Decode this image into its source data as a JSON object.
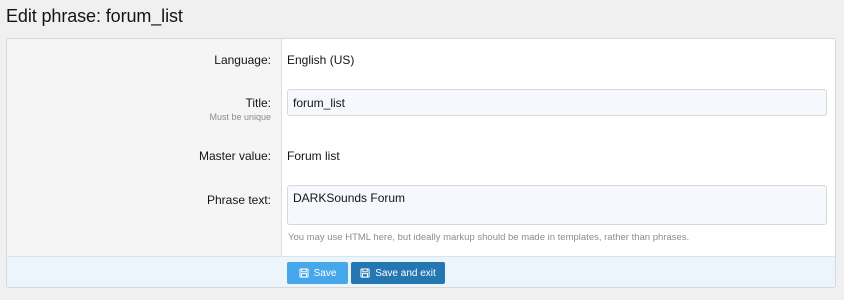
{
  "page": {
    "title": "Edit phrase: forum_list"
  },
  "form": {
    "language": {
      "label": "Language:",
      "value": "English (US)"
    },
    "title": {
      "label": "Title:",
      "hint": "Must be unique",
      "value": "forum_list"
    },
    "master_value": {
      "label": "Master value:",
      "value": "Forum list"
    },
    "phrase_text": {
      "label": "Phrase text:",
      "value": "DARKSounds Forum",
      "explain": "You may use HTML here, but ideally markup should be made in templates, rather than phrases."
    }
  },
  "footer": {
    "save_label": "Save",
    "save_exit_label": "Save and exit",
    "save_icon": "save-icon"
  },
  "colors": {
    "primary_button": "#47a7eb",
    "secondary_button": "#2577b1",
    "footer_background": "#edf5fc",
    "input_background": "#f5f9fd"
  }
}
